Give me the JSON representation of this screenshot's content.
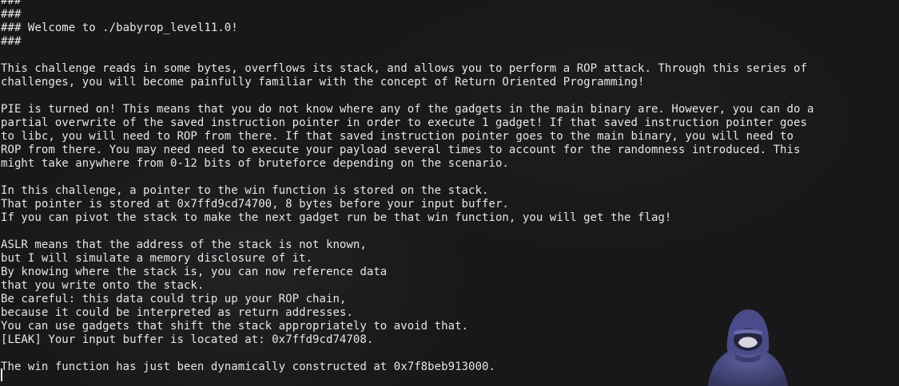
{
  "terminal": {
    "lines": [
      "###   ",
      "###",
      "### Welcome to ./babyrop_level11.0!",
      "###",
      "",
      "This challenge reads in some bytes, overflows its stack, and allows you to perform a ROP attack. Through this series of",
      "challenges, you will become painfully familiar with the concept of Return Oriented Programming!",
      "",
      "PIE is turned on! This means that you do not know where any of the gadgets in the main binary are. However, you can do a",
      "partial overwrite of the saved instruction pointer in order to execute 1 gadget! If that saved instruction pointer goes",
      "to libc, you will need to ROP from there. If that saved instruction pointer goes to the main binary, you will need to",
      "ROP from there. You may need need to execute your payload several times to account for the randomness introduced. This",
      "might take anywhere from 0-12 bits of bruteforce depending on the scenario.",
      "",
      "In this challenge, a pointer to the win function is stored on the stack.",
      "That pointer is stored at 0x7ffd9cd74700, 8 bytes before your input buffer.",
      "If you can pivot the stack to make the next gadget run be that win function, you will get the flag!",
      "",
      "ASLR means that the address of the stack is not known,",
      "but I will simulate a memory disclosure of it.",
      "By knowing where the stack is, you can now reference data",
      "that you write onto the stack.",
      "Be careful: this data could trip up your ROP chain,",
      "because it could be interpreted as return addresses.",
      "You can use gadgets that shift the stack appropriately to avoid that.",
      "[LEAK] Your input buffer is located at: 0x7ffd9cd74708.",
      "",
      "The win function has just been dynamically constructed at 0x7f8beb913000."
    ]
  },
  "colors": {
    "background": "#18181a",
    "text": "#e6e6e6",
    "cursor": "#f0f0f0",
    "figure_hood": "#4a4c8a",
    "figure_face": "#d8d4e0"
  },
  "icons": {
    "wallpaper_figure": "hooded-figure-icon"
  }
}
